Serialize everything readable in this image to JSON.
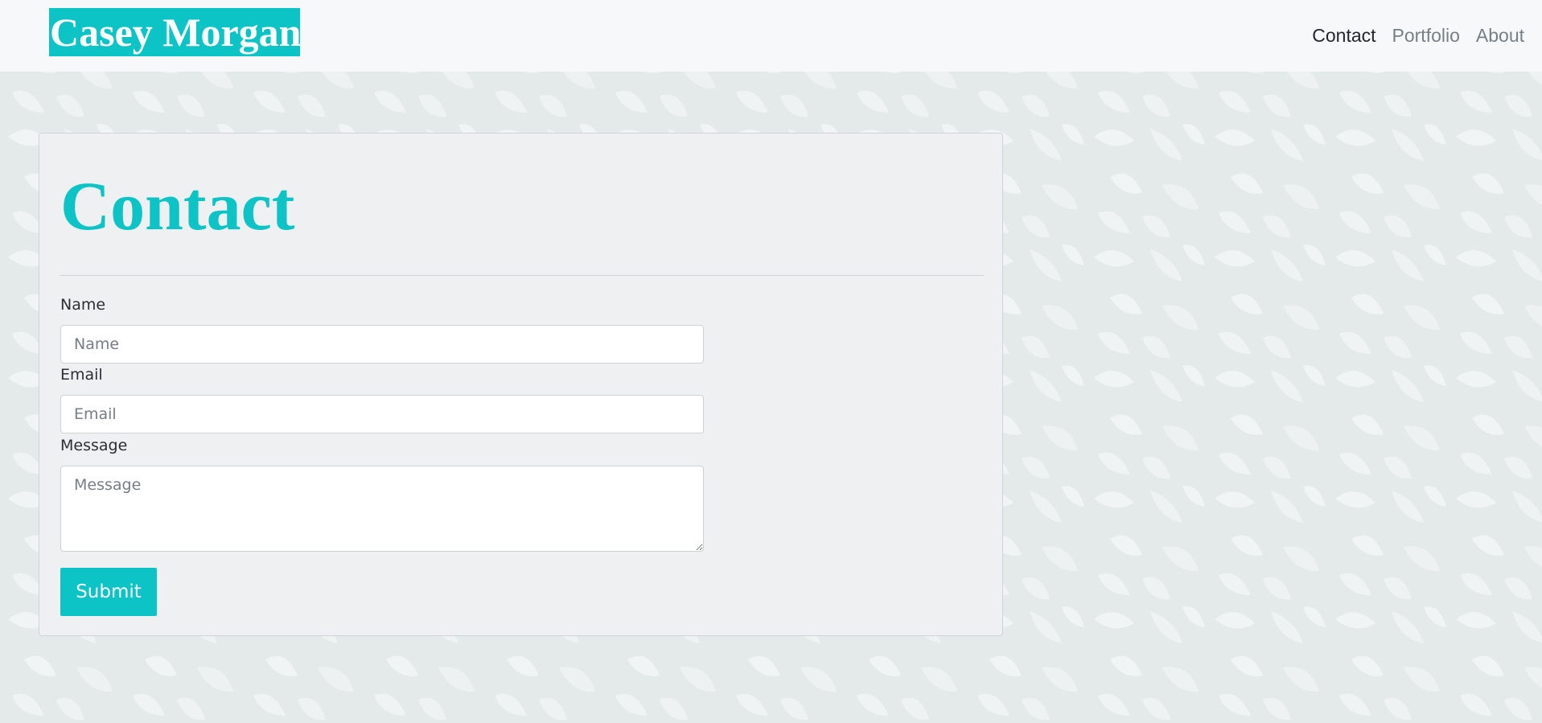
{
  "navbar": {
    "brand": "Casey Morgan",
    "links": [
      {
        "label": "Contact",
        "active": true
      },
      {
        "label": "Portfolio",
        "active": false
      },
      {
        "label": "About",
        "active": false
      }
    ]
  },
  "contact": {
    "title": "Contact",
    "fields": {
      "name": {
        "label": "Name",
        "placeholder": "Name",
        "value": ""
      },
      "email": {
        "label": "Email",
        "placeholder": "Email",
        "value": ""
      },
      "message": {
        "label": "Message",
        "placeholder": "Message",
        "value": ""
      }
    },
    "submit_label": "Submit"
  },
  "colors": {
    "accent": "#0cc4c5",
    "navbar_bg": "#f7f8f9",
    "card_bg": "#eef0f2",
    "page_bg": "#e4e9ea"
  },
  "background": {
    "pattern": "leaf-pattern"
  }
}
